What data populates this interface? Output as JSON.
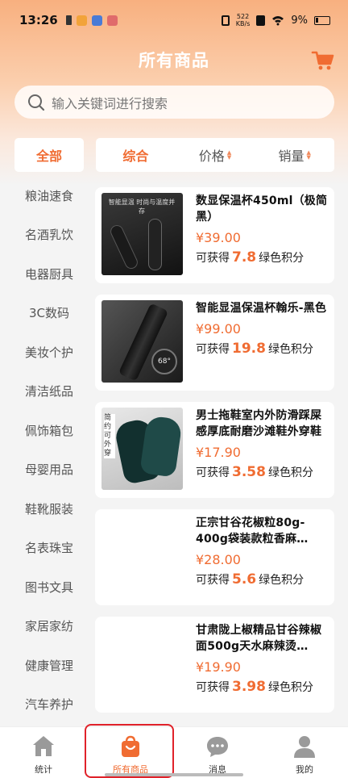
{
  "status_bar": {
    "time": "13:26",
    "network_speed_value": "522",
    "network_speed_unit": "KB/s",
    "battery": "9%"
  },
  "header": {
    "title": "所有商品",
    "cart_icon": "cart-icon"
  },
  "search": {
    "placeholder": "输入关键词进行搜索"
  },
  "category_all": "全部",
  "sort": {
    "tabs": [
      {
        "label": "综合",
        "active": true
      },
      {
        "label": "价格",
        "active": false
      },
      {
        "label": "销量",
        "active": false
      }
    ]
  },
  "categories": [
    "粮油速食",
    "名酒乳饮",
    "电器厨具",
    "3C数码",
    "美妆个护",
    "清洁纸品",
    "佩饰箱包",
    "母婴用品",
    "鞋靴服装",
    "名表珠宝",
    "图书文具",
    "家居家纺",
    "健康管理",
    "汽车养护"
  ],
  "points_label_prefix": "可获得",
  "points_label_suffix": "绿色积分",
  "products": [
    {
      "name": "数显保温杯450ml（极简黑）",
      "price": "¥39.00",
      "points": "7.8",
      "image_text": "智能显温 时尚与温度并存"
    },
    {
      "name": "智能显温保温杯翰乐-黑色",
      "price": "¥99.00",
      "points": "19.8",
      "image_text": "68°"
    },
    {
      "name": "男士拖鞋室内外防滑踩屎感厚底耐磨沙滩鞋外穿鞋",
      "price": "¥17.90",
      "points": "3.58",
      "image_text": "简约 可外穿"
    },
    {
      "name": "正宗甘谷花椒粒80g-400g袋装款粒香麻…",
      "price": "¥28.00",
      "points": "5.6",
      "image_text": ""
    },
    {
      "name": "甘肃陇上椒精品甘谷辣椒面500g天水麻辣烫…",
      "price": "¥19.90",
      "points": "3.98",
      "image_text": ""
    }
  ],
  "tab_bar": {
    "tabs": [
      {
        "label": "统计",
        "icon": "home-icon",
        "active": false
      },
      {
        "label": "所有商品",
        "icon": "shopping-bag-icon",
        "active": true
      },
      {
        "label": "消息",
        "icon": "chat-icon",
        "active": false
      },
      {
        "label": "我的",
        "icon": "user-icon",
        "active": false
      }
    ]
  },
  "colors": {
    "accent": "#f06c32",
    "highlight_box": "#e0222a"
  }
}
